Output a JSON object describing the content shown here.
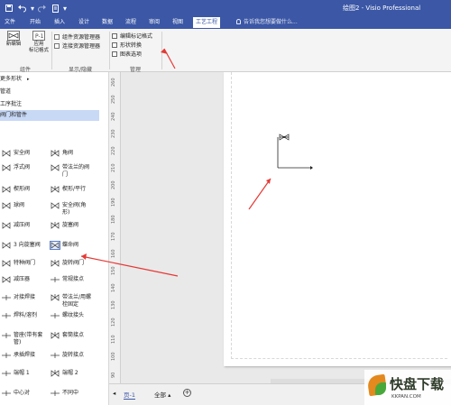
{
  "window": {
    "title": "绘图2 - Visio Professional"
  },
  "colors": {
    "brand": "#3b57a6",
    "arrow": "#e53935",
    "selected_nav": "#c8d9f6"
  },
  "quick_access": {
    "icons": [
      "save-icon",
      "undo-icon",
      "redo-icon",
      "print-preview-icon"
    ]
  },
  "tabs": [
    "文件",
    "开始",
    "插入",
    "设计",
    "数据",
    "流程",
    "审阅",
    "视图",
    "工艺工程"
  ],
  "active_tab": "工艺工程",
  "tell_me": "告诉我您想要做什么...",
  "ribbon": {
    "groups": [
      {
        "label": "组件",
        "buttons": [
          {
            "icon": "new-component-icon",
            "label": "新编辑"
          },
          {
            "icon": "apply-tag-icon",
            "label": "应用\n标记格式"
          }
        ]
      },
      {
        "label": "显示/隐藏",
        "checkboxes": [
          {
            "label": "组件资源管理器",
            "checked": false
          },
          {
            "label": "连接资源管理器",
            "checked": false
          }
        ]
      },
      {
        "label": "管理",
        "buttons": [
          {
            "icon": "edit-tag-format-icon",
            "label": "编辑标记格式"
          },
          {
            "icon": "shape-convert-icon",
            "label": "形状转换"
          },
          {
            "icon": "drawing-options-icon",
            "label": "图表选项"
          }
        ]
      }
    ]
  },
  "shapes_panel": {
    "nav": [
      {
        "label": "更多形状",
        "arrow": "▸"
      },
      {
        "label": "管道"
      },
      {
        "label": "工序批注"
      },
      {
        "label": "阀门和管件",
        "selected": true
      }
    ],
    "shapes": [
      {
        "label": "安全阀",
        "icon": "safety-valve-icon"
      },
      {
        "label": "角阀",
        "icon": "angle-valve-icon"
      },
      {
        "label": "浮式阀",
        "icon": "float-valve-icon"
      },
      {
        "label": "带法兰的阀\n门",
        "icon": "flanged-valve-icon"
      },
      {
        "label": "楔形阀",
        "icon": "wedge-valve-icon"
      },
      {
        "label": "楔形/平行",
        "icon": "wedge-parallel-valve-icon"
      },
      {
        "label": "球阀",
        "icon": "ball-valve-icon"
      },
      {
        "label": "安全阀(角\n形)",
        "icon": "safety-angle-valve-icon"
      },
      {
        "label": "减压阀",
        "icon": "reducing-valve-icon"
      },
      {
        "label": "旋塞阀",
        "icon": "plug-valve-icon"
      },
      {
        "label": "3 向旋塞阀",
        "icon": "three-way-plug-valve-icon"
      },
      {
        "label": "蝶命阀",
        "icon": "butterfly-valve-icon",
        "selected": true
      },
      {
        "label": "特种阀门",
        "icon": "special-valve-icon"
      },
      {
        "label": "旋转阀门",
        "icon": "rotary-valve-icon"
      },
      {
        "label": "减压器",
        "icon": "pressure-reducer-icon"
      },
      {
        "label": "常规接点",
        "icon": "regular-joint-icon"
      },
      {
        "label": "对接焊接",
        "icon": "butt-weld-icon"
      },
      {
        "label": "带法兰/用螺\n栓固定",
        "icon": "flanged-bolted-icon"
      },
      {
        "label": "焊料/溶剂",
        "icon": "solder-solvent-icon"
      },
      {
        "label": "螺纹接头",
        "icon": "threaded-joint-icon"
      },
      {
        "label": "管座(带有套\n管)",
        "icon": "pipe-sleeve-icon"
      },
      {
        "label": "套筒接点",
        "icon": "sleeve-joint-icon"
      },
      {
        "label": "承插焊接",
        "icon": "socket-weld-icon"
      },
      {
        "label": "旋转接点",
        "icon": "swivel-joint-icon"
      },
      {
        "label": "端帽 1",
        "icon": "end-cap-1-icon"
      },
      {
        "label": "端帽 2",
        "icon": "end-cap-2-icon"
      },
      {
        "label": "中心对",
        "icon": "center-icon"
      },
      {
        "label": "不同中",
        "icon": "offset-icon"
      }
    ]
  },
  "ruler": {
    "ticks": [
      "260",
      "250",
      "240",
      "230",
      "220",
      "210",
      "200",
      "190",
      "180",
      "170",
      "160",
      "150",
      "140",
      "130",
      "120",
      "110",
      "100",
      "90"
    ]
  },
  "page_tabs": {
    "current": "页-1",
    "all": "全部"
  }
}
